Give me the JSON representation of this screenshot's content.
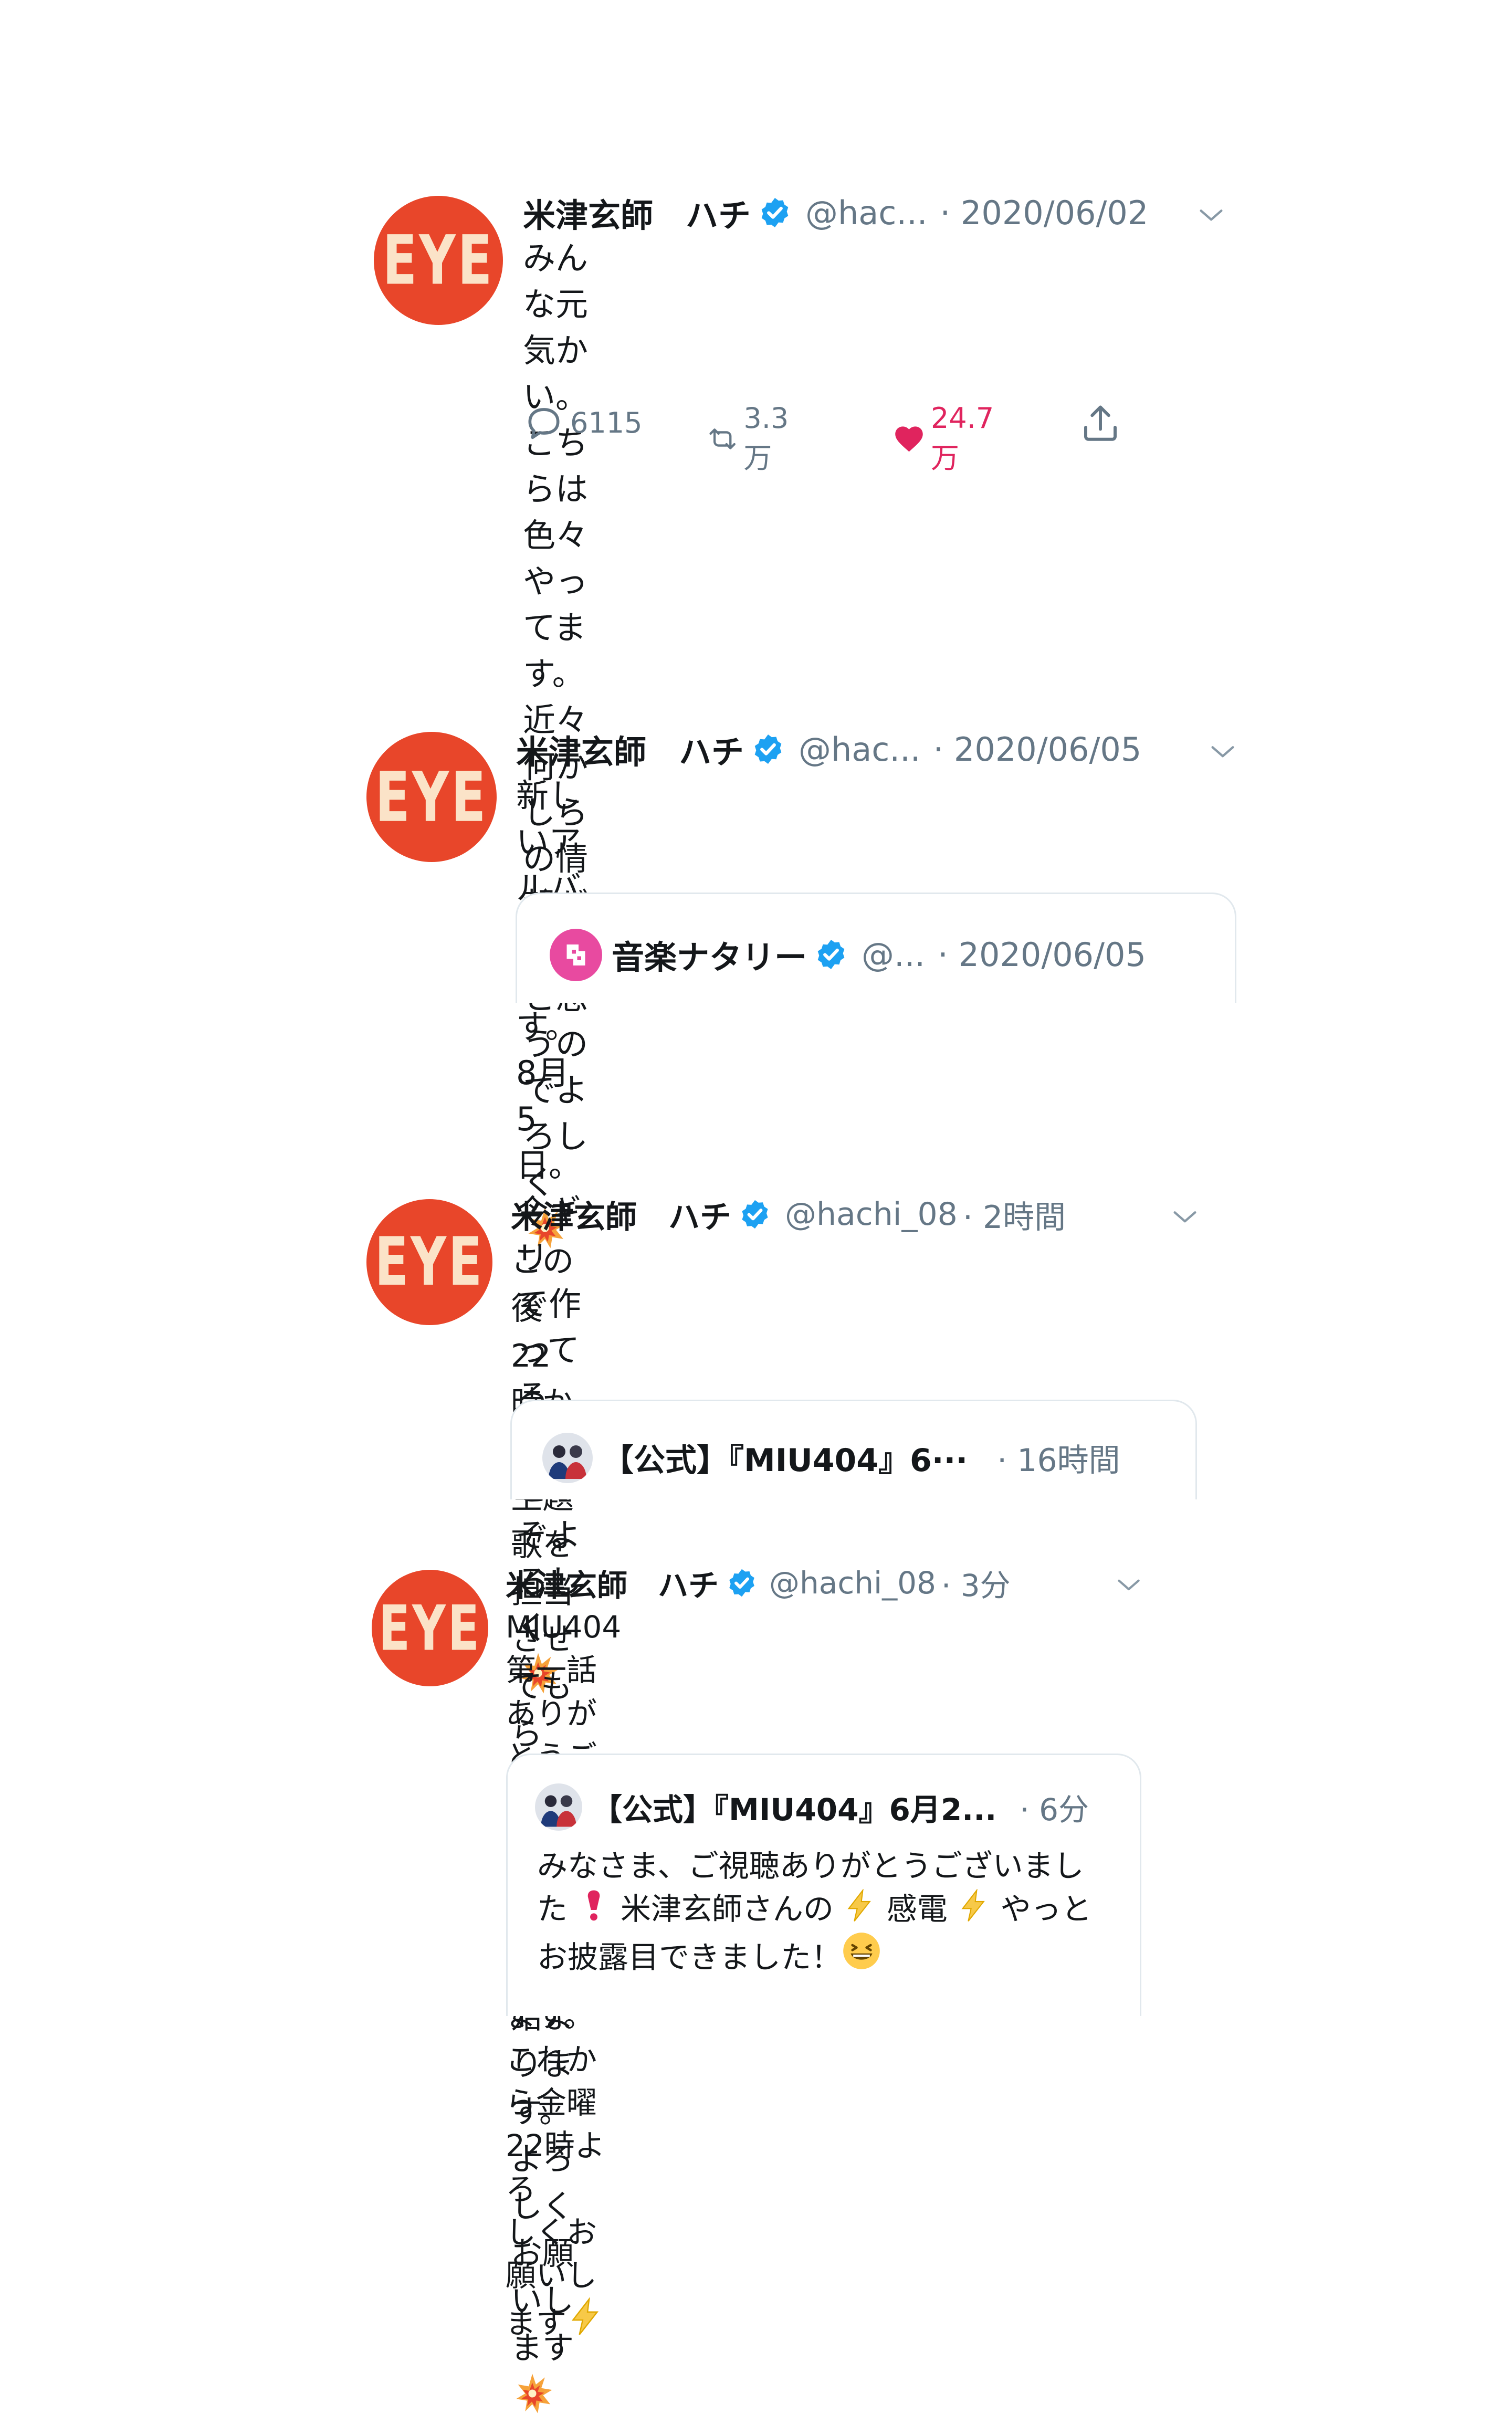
{
  "tweets": [
    {
      "name": "米津玄師　ハチ",
      "handle": "@hac...",
      "time": "· 2020/06/02",
      "avatar_text": "EYE",
      "lines": [
        "みんな元気かい。こちらは色々やってます。",
        "近々何かしらの情報が出ると思うのでよろし",
        "く"
      ],
      "end_emoji": "collision-icon",
      "actions": {
        "reply": "6115",
        "retweet": "3.3万",
        "like": "24.7万"
      }
    },
    {
      "name": "米津玄師　ハチ",
      "handle": "@hac...",
      "time": "· 2020/06/05",
      "avatar_text": "EYE",
      "lines": [
        "新しいアルバムが出ます。8月5日。今ギリ",
        "で作ってるよ。どうぞよろしく"
      ],
      "end_emoji": "collision-icon",
      "quote": {
        "name": "音楽ナタリー",
        "handle": "@...",
        "time": "· 2020/06/05"
      }
    },
    {
      "name": "米津玄師　ハチ",
      "handle": "@hachi_08",
      "time": "· 2時間",
      "avatar_text": "EYE",
      "lines": [
        "この後22時から。主題歌を担当させてもら",
        "っています。いよいよ始まります。よろしく",
        "お願いします"
      ],
      "end_emoji": "collision-icon",
      "quote": {
        "name": "【公式】『MIU404』6···",
        "time": "· 16時間"
      }
    },
    {
      "name": "米津玄師　ハチ",
      "handle": "@hachi_08",
      "time": "· 3分",
      "avatar_text": "EYE",
      "lines": [
        "MIU404第一話ありがとうございました。爆",
        "上がっております。これから金曜22時よろ",
        "しくお願いします"
      ],
      "end_emoji": "lightning-icon",
      "quote": {
        "name": "【公式】『MIU404』6月2...",
        "time": "· 6分",
        "line1": "みなさま、ご視聴ありがとうございまし",
        "line2_a": "た",
        "line2_b": "米津玄師さんの",
        "line2_c": "感電",
        "line2_d": "やっと",
        "line3": "お披露目できました！"
      }
    }
  ],
  "colors": {
    "accent": "#1da1f2",
    "like": "#e0245e",
    "avatar": "#e8462a",
    "muted": "#657786"
  }
}
